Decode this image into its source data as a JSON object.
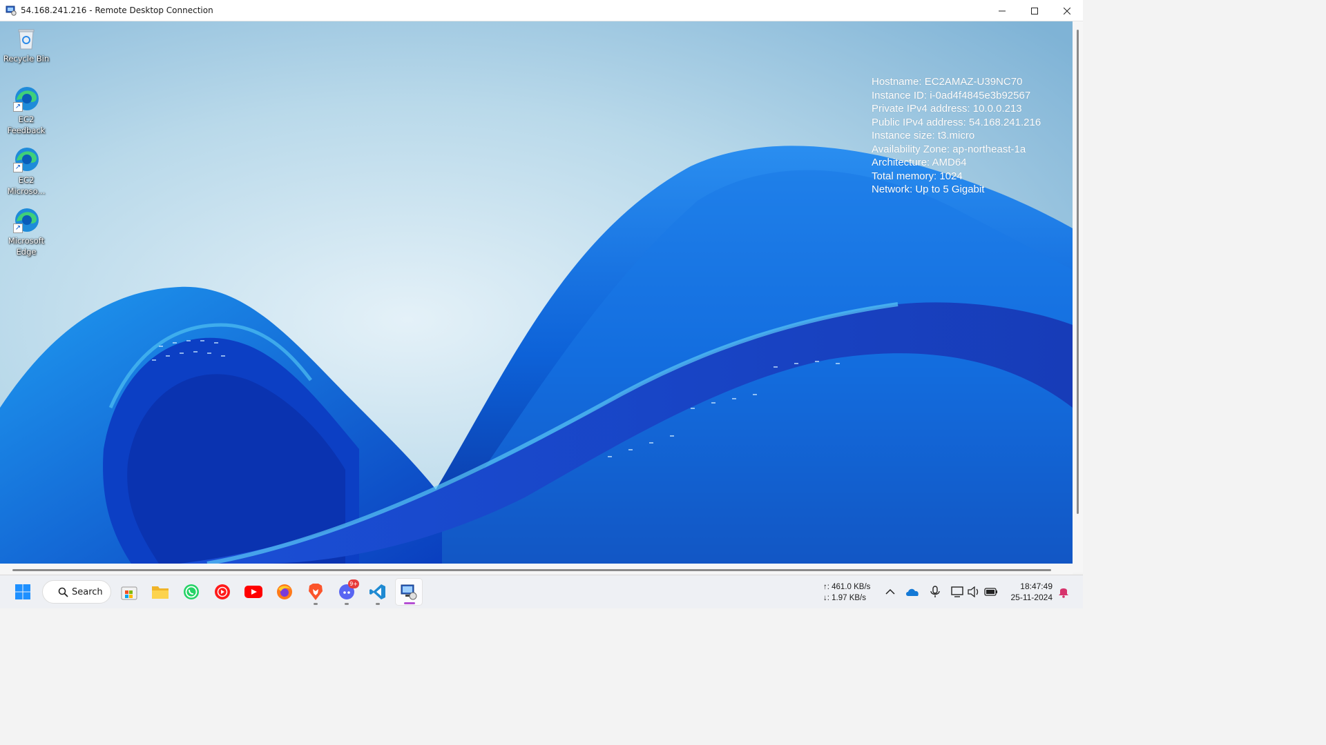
{
  "window": {
    "title": "54.168.241.216 - Remote Desktop Connection",
    "icon": "remote-desktop-icon",
    "controls": [
      "minimize",
      "maximize",
      "close"
    ]
  },
  "desktop": {
    "icons": [
      {
        "label": "Recycle Bin",
        "icon": "recycle-bin-icon"
      },
      {
        "label": "EC2\nFeedback",
        "icon": "edge-shortcut-icon"
      },
      {
        "label": "EC2\nMicroso...",
        "icon": "edge-shortcut-icon"
      },
      {
        "label": "Microsoft\nEdge",
        "icon": "edge-shortcut-icon"
      }
    ],
    "instance_info": [
      "Hostname: EC2AMAZ-U39NC70",
      "Instance ID: i-0ad4f4845e3b92567",
      "Private IPv4 address: 10.0.0.213",
      "Public IPv4 address: 54.168.241.216",
      "Instance size: t3.micro",
      "Availability Zone: ap-northeast-1a",
      "Architecture: AMD64",
      "Total memory: 1024",
      "Network: Up to 5 Gigabit"
    ]
  },
  "taskbar": {
    "search_label": "Search",
    "apps": [
      {
        "name": "start",
        "icon": "windows-start-icon"
      },
      {
        "name": "microsoft-store",
        "icon": "store-icon"
      },
      {
        "name": "file-explorer",
        "icon": "folder-icon"
      },
      {
        "name": "whatsapp",
        "icon": "whatsapp-icon"
      },
      {
        "name": "youtube-music",
        "icon": "youtube-music-icon"
      },
      {
        "name": "youtube",
        "icon": "youtube-icon"
      },
      {
        "name": "firefox",
        "icon": "firefox-icon"
      },
      {
        "name": "brave",
        "icon": "brave-icon"
      },
      {
        "name": "discord",
        "icon": "discord-icon",
        "badge": "9+"
      },
      {
        "name": "vscode",
        "icon": "vscode-icon"
      },
      {
        "name": "remote-desktop",
        "icon": "remote-desktop-icon",
        "active": true
      }
    ],
    "network": {
      "upload": "↑: 461.0 KB/s",
      "download": "↓: 1.97 KB/s"
    },
    "tray_icons": [
      "chevron-up-icon",
      "onedrive-icon",
      "microphone-icon",
      "display-icon",
      "speaker-icon",
      "battery-icon"
    ],
    "clock": {
      "time": "18:47:49",
      "date": "25-11-2024"
    },
    "notification_icon": "bell-icon"
  },
  "colors": {
    "wallpaper_sky": "#a9cde3",
    "wallpaper_blue": "#1a6ee0",
    "wallpaper_deep": "#0a2fa8",
    "accent_active": "#b44fd3"
  }
}
